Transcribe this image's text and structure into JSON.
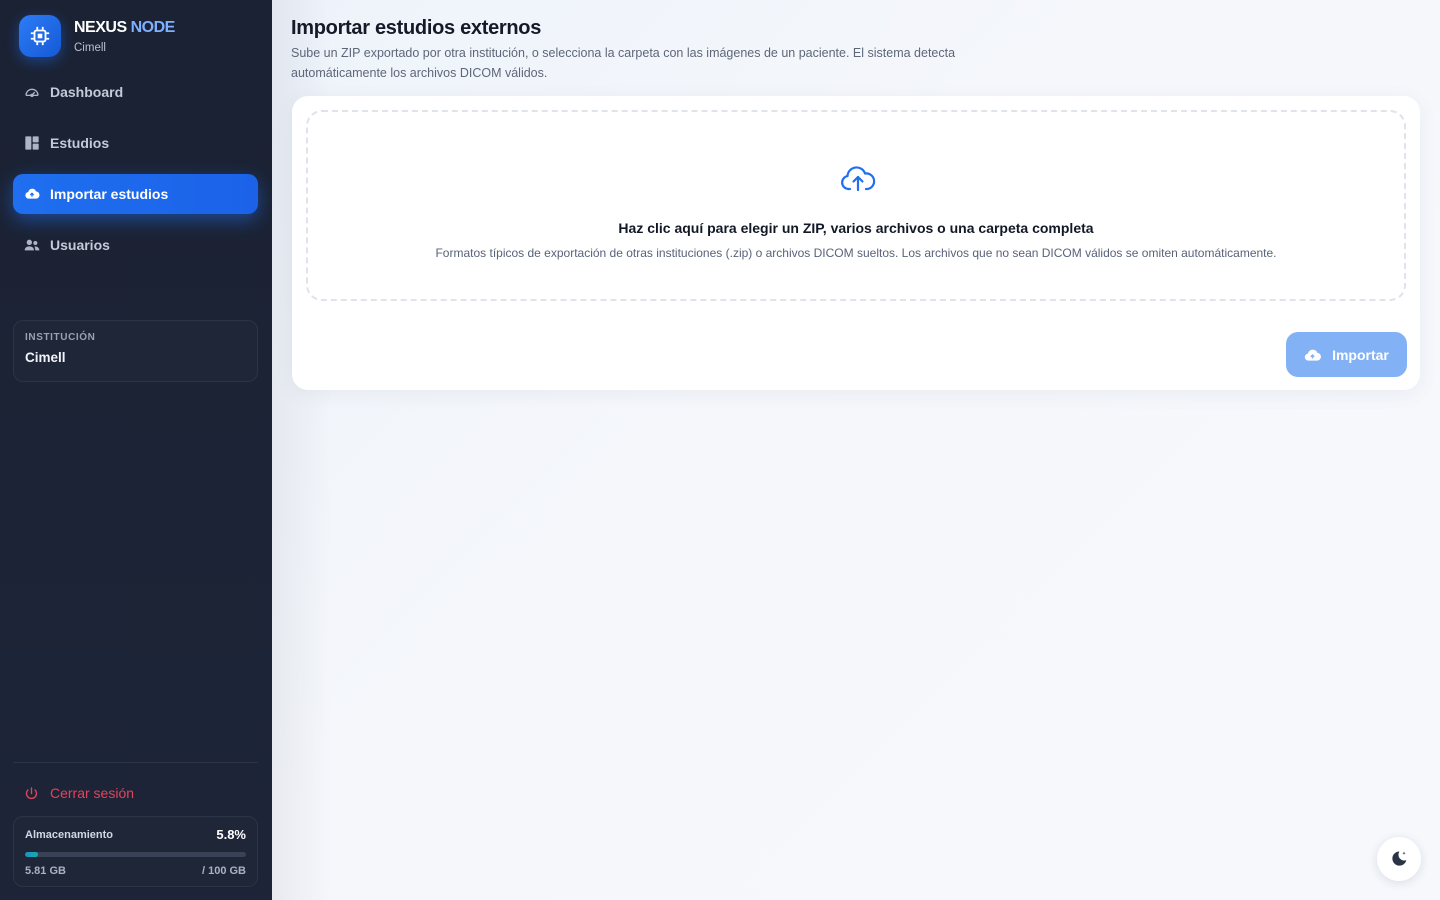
{
  "brand": {
    "title_main": "NEXUS",
    "title_accent": "NODE",
    "subtitle": "Cimell"
  },
  "sidebar": {
    "items": [
      {
        "label": "Dashboard",
        "icon": "gauge-icon",
        "active": false
      },
      {
        "label": "Estudios",
        "icon": "grid-icon",
        "active": false
      },
      {
        "label": "Importar estudios",
        "icon": "cloud-upload-icon",
        "active": true
      },
      {
        "label": "Usuarios",
        "icon": "users-icon",
        "active": false
      }
    ],
    "institution": {
      "label": "INSTITUCIÓN",
      "value": "Cimell"
    },
    "logout_label": "Cerrar sesión",
    "storage": {
      "label": "Almacenamiento",
      "percent_text": "5.8%",
      "used": "5.81 GB",
      "total": "/ 100 GB",
      "fraction": 0.058
    }
  },
  "main": {
    "title": "Importar estudios externos",
    "description": "Sube un ZIP exportado por otra institución, o selecciona la carpeta con las imágenes de un paciente. El sistema detecta automáticamente los archivos DICOM válidos.",
    "dropzone": {
      "title": "Haz clic aquí para elegir un ZIP, varios archivos o una carpeta completa",
      "subtitle": "Formatos típicos de exportación de otras instituciones (.zip) o archivos DICOM sueltos. Los archivos que no sean DICOM válidos se omiten automáticamente."
    },
    "import_button": "Importar"
  },
  "colors": {
    "accent": "#1f6ff0",
    "danger": "#e0455a",
    "sidebar_bg": "#1b2233"
  }
}
